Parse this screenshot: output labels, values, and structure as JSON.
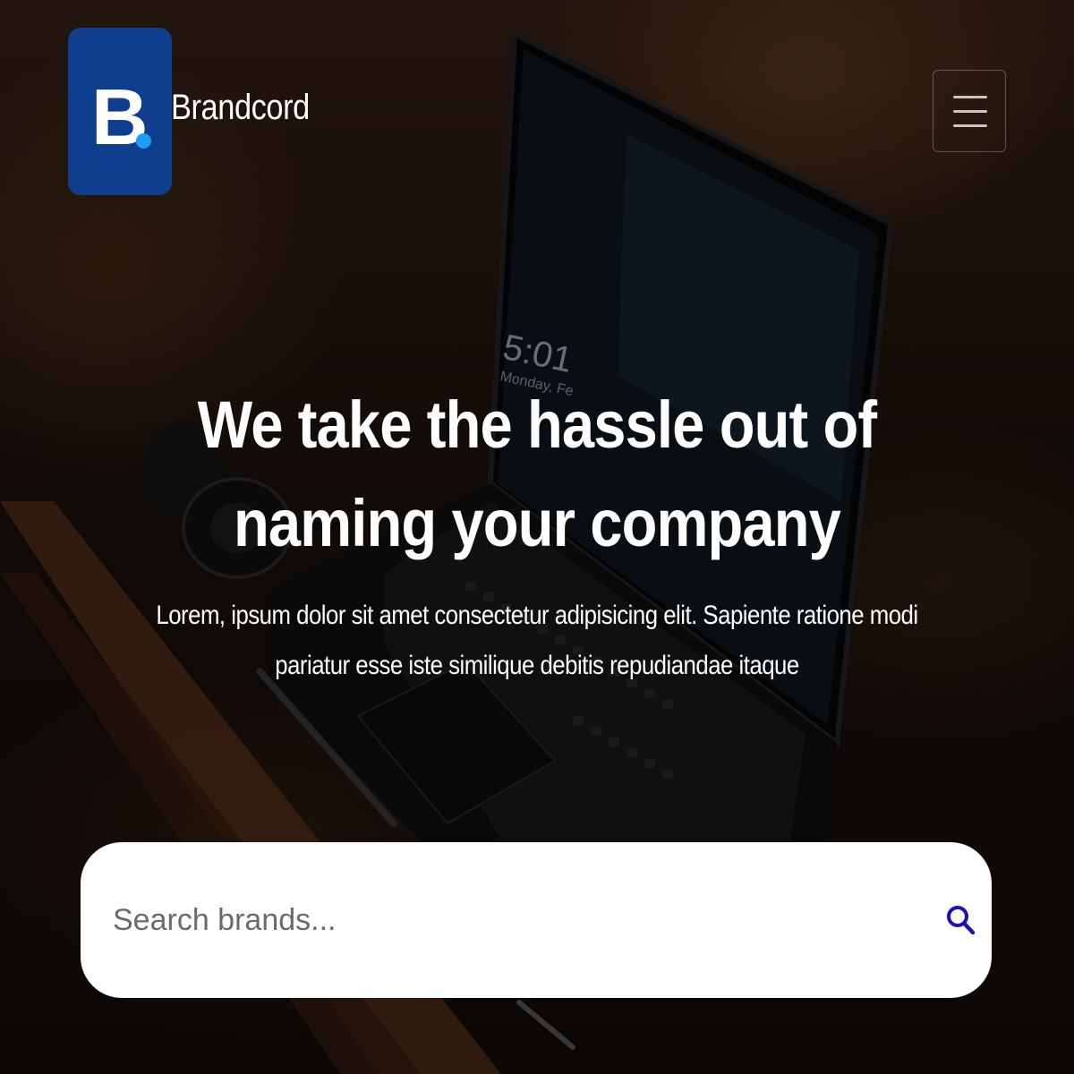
{
  "header": {
    "logo_letter": "B",
    "brand_name": "Brandcord",
    "menu_icon": "hamburger-menu-icon"
  },
  "hero": {
    "title": "We take the hassle out of naming your company",
    "subtitle": "Lorem, ipsum dolor sit amet consectetur adipisicing elit. Sapiente ratione modi pariatur esse iste similique debitis repudiandae itaque"
  },
  "search": {
    "placeholder": "Search brands...",
    "value": "",
    "icon": "search-icon"
  },
  "colors": {
    "logo_bg": "#0f3e8f",
    "logo_dot": "#1e9df5",
    "search_icon": "#1a12b8",
    "text": "#ffffff"
  }
}
